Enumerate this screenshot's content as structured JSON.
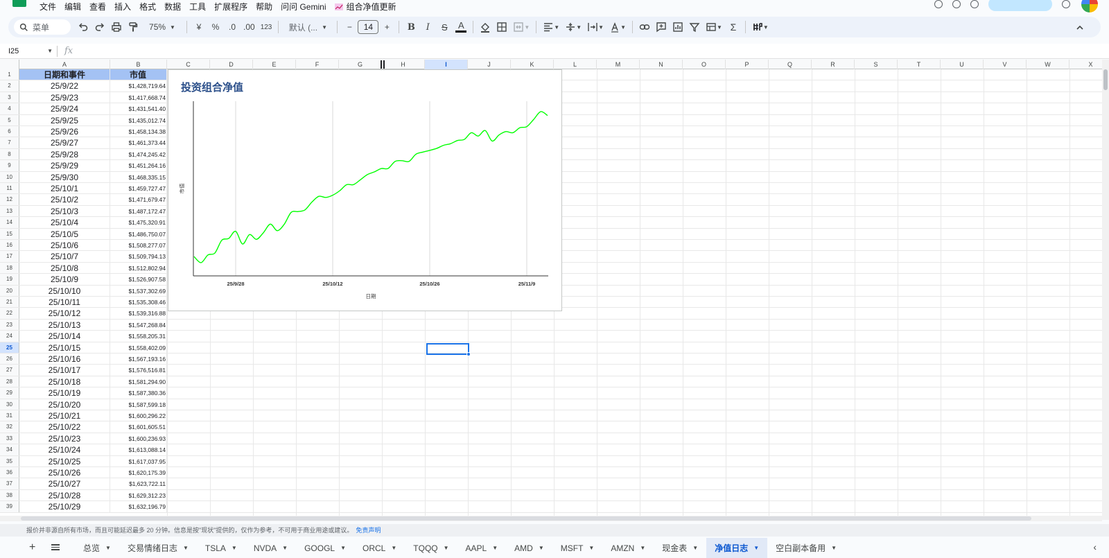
{
  "menu": {
    "items": [
      "文件",
      "编辑",
      "查看",
      "插入",
      "格式",
      "数据",
      "工具",
      "扩展程序",
      "帮助",
      "问问 Gemini"
    ],
    "extension_label": "组合净值更新"
  },
  "toolbar": {
    "search_placeholder": "菜单",
    "zoom": "75%",
    "currency": "¥",
    "percent": "%",
    "dec_decrease": ".0",
    "dec_increase": ".00",
    "number_format": "123",
    "font": "默认 (...",
    "font_size": "14",
    "minus": "−",
    "plus": "+",
    "bold": "B",
    "italic": "I",
    "strike": "S",
    "text_color": "A",
    "sigma": "Σ"
  },
  "formula_bar": {
    "cell_ref": "I25",
    "fx": "fx",
    "content": ""
  },
  "columns": [
    "A",
    "B",
    "C",
    "D",
    "E",
    "F",
    "G",
    "H",
    "I",
    "J",
    "K",
    "L",
    "M",
    "N",
    "O",
    "P",
    "Q",
    "R",
    "S",
    "T",
    "U",
    "V",
    "W",
    "X"
  ],
  "selected_column": "I",
  "selected_row": 25,
  "table": {
    "header": {
      "a": "日期和事件",
      "b": "市值"
    },
    "rows": [
      {
        "a": "25/9/22",
        "b": "$1,428,719.64"
      },
      {
        "a": "25/9/23",
        "b": "$1,417,668.74"
      },
      {
        "a": "25/9/24",
        "b": "$1,431,541.40"
      },
      {
        "a": "25/9/25",
        "b": "$1,435,012.74"
      },
      {
        "a": "25/9/26",
        "b": "$1,458,134.38"
      },
      {
        "a": "25/9/27",
        "b": "$1,461,373.44"
      },
      {
        "a": "25/9/28",
        "b": "$1,474,245.42"
      },
      {
        "a": "25/9/29",
        "b": "$1,451,264.16"
      },
      {
        "a": "25/9/30",
        "b": "$1,468,335.15"
      },
      {
        "a": "25/10/1",
        "b": "$1,459,727.47"
      },
      {
        "a": "25/10/2",
        "b": "$1,471,679.47"
      },
      {
        "a": "25/10/3",
        "b": "$1,487,172.47"
      },
      {
        "a": "25/10/4",
        "b": "$1,475,320.91"
      },
      {
        "a": "25/10/5",
        "b": "$1,486,750.07"
      },
      {
        "a": "25/10/6",
        "b": "$1,508,277.07"
      },
      {
        "a": "25/10/7",
        "b": "$1,509,794.13"
      },
      {
        "a": "25/10/8",
        "b": "$1,512,802.94"
      },
      {
        "a": "25/10/9",
        "b": "$1,526,907.58"
      },
      {
        "a": "25/10/10",
        "b": "$1,537,302.69"
      },
      {
        "a": "25/10/11",
        "b": "$1,535,308.46"
      },
      {
        "a": "25/10/12",
        "b": "$1,539,316.88"
      },
      {
        "a": "25/10/13",
        "b": "$1,547,268.84"
      },
      {
        "a": "25/10/14",
        "b": "$1,558,205.31"
      },
      {
        "a": "25/10/15",
        "b": "$1,558,402.09"
      },
      {
        "a": "25/10/16",
        "b": "$1,567,193.16"
      },
      {
        "a": "25/10/17",
        "b": "$1,576,516.81"
      },
      {
        "a": "25/10/18",
        "b": "$1,581,294.90"
      },
      {
        "a": "25/10/19",
        "b": "$1,587,380.36"
      },
      {
        "a": "25/10/20",
        "b": "$1,587,599.18"
      },
      {
        "a": "25/10/21",
        "b": "$1,600,296.22"
      },
      {
        "a": "25/10/22",
        "b": "$1,601,605.51"
      },
      {
        "a": "25/10/23",
        "b": "$1,600,236.93"
      },
      {
        "a": "25/10/24",
        "b": "$1,613,088.14"
      },
      {
        "a": "25/10/25",
        "b": "$1,617,037.95"
      },
      {
        "a": "25/10/26",
        "b": "$1,620,175.39"
      },
      {
        "a": "25/10/27",
        "b": "$1,623,722.11"
      },
      {
        "a": "25/10/28",
        "b": "$1,629,312.23"
      },
      {
        "a": "25/10/29",
        "b": "$1,632,196.79"
      }
    ]
  },
  "chart_data": {
    "type": "line",
    "title": "投资组合净值",
    "xlabel": "日期",
    "ylabel": "市值",
    "x_ticks": [
      "25/9/28",
      "25/10/12",
      "25/10/26",
      "25/11/9"
    ],
    "line_color": "#00ff00",
    "grid": "vertical",
    "legend": "none",
    "x": [
      "25/9/22",
      "25/9/23",
      "25/9/24",
      "25/9/25",
      "25/9/26",
      "25/9/27",
      "25/9/28",
      "25/9/29",
      "25/9/30",
      "25/10/1",
      "25/10/2",
      "25/10/3",
      "25/10/4",
      "25/10/5",
      "25/10/6",
      "25/10/7",
      "25/10/8",
      "25/10/9",
      "25/10/10",
      "25/10/11",
      "25/10/12",
      "25/10/13",
      "25/10/14",
      "25/10/15",
      "25/10/16",
      "25/10/17",
      "25/10/18",
      "25/10/19",
      "25/10/20",
      "25/10/21",
      "25/10/22",
      "25/10/23",
      "25/10/24",
      "25/10/25",
      "25/10/26",
      "25/10/27",
      "25/10/28",
      "25/10/29",
      "25/10/30",
      "25/10/31",
      "25/11/1",
      "25/11/2",
      "25/11/3",
      "25/11/4",
      "25/11/5",
      "25/11/6",
      "25/11/7",
      "25/11/8",
      "25/11/9",
      "25/11/10",
      "25/11/11",
      "25/11/12"
    ],
    "values": [
      1428719.64,
      1417668.74,
      1431541.4,
      1435012.74,
      1458134.38,
      1461373.44,
      1474245.42,
      1451264.16,
      1468335.15,
      1459727.47,
      1471679.47,
      1487172.47,
      1475320.91,
      1486750.07,
      1508277.07,
      1509794.13,
      1512802.94,
      1526907.58,
      1537302.69,
      1535308.46,
      1539316.88,
      1547268.84,
      1558205.31,
      1558402.09,
      1567193.16,
      1576516.81,
      1581294.9,
      1587380.36,
      1587599.18,
      1600296.22,
      1601605.51,
      1600236.93,
      1613088.14,
      1617037.95,
      1620175.39,
      1623722.11,
      1629312.23,
      1632196.79,
      1638000,
      1640000,
      1652000,
      1646000,
      1656000,
      1637000,
      1648000,
      1654000,
      1652000,
      1661000,
      1663000,
      1676000,
      1690000,
      1683000
    ]
  },
  "disclaimer": {
    "text": "报价并非源自所有市场，而且可能延迟最多 20 分钟。信息是按\"现状\"提供的，仅作为参考，不可用于商业用途或建议。",
    "link": "免责声明"
  },
  "tabs": [
    {
      "label": "总览",
      "active": false
    },
    {
      "label": "交易情绪日志",
      "active": false
    },
    {
      "label": "TSLA",
      "active": false
    },
    {
      "label": "NVDA",
      "active": false
    },
    {
      "label": "GOOGL",
      "active": false
    },
    {
      "label": "ORCL",
      "active": false
    },
    {
      "label": "TQQQ",
      "active": false
    },
    {
      "label": "AAPL",
      "active": false
    },
    {
      "label": "AMD",
      "active": false
    },
    {
      "label": "MSFT",
      "active": false
    },
    {
      "label": "AMZN",
      "active": false
    },
    {
      "label": "现金表",
      "active": false
    },
    {
      "label": "净值日志",
      "active": true
    },
    {
      "label": "空白副本备用",
      "active": false
    }
  ],
  "tab_add": "+",
  "tab_nav": "‹"
}
